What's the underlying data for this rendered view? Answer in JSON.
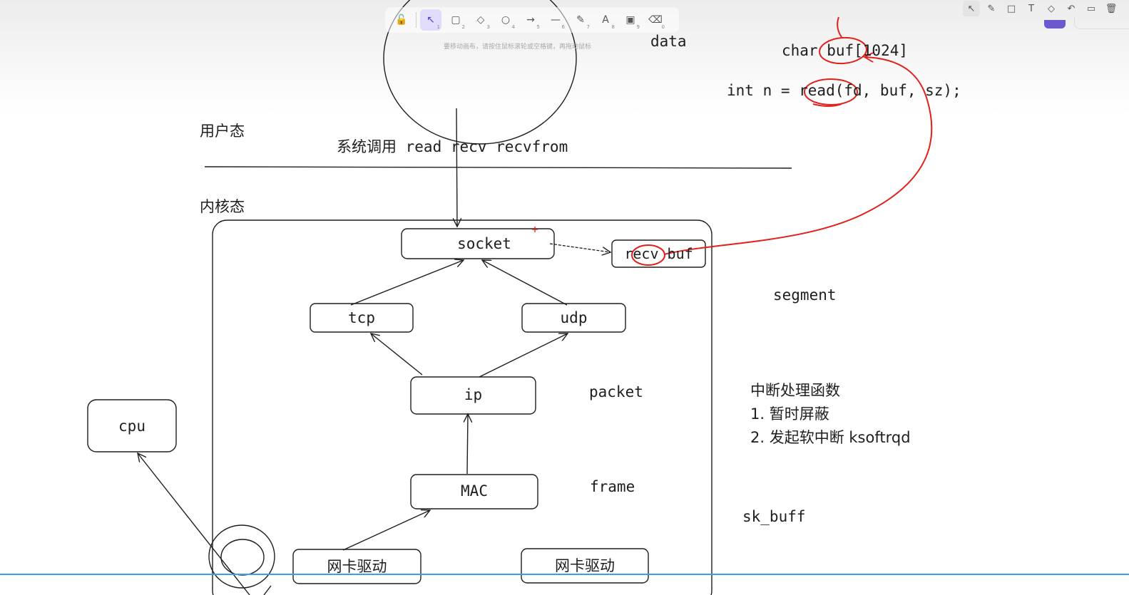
{
  "toolbar": {
    "tools": [
      {
        "name": "lock-tool",
        "glyph": "🔓",
        "sub": ""
      },
      {
        "name": "selection-tool",
        "glyph": "↖",
        "sub": "1"
      },
      {
        "name": "rectangle-tool",
        "glyph": "▢",
        "sub": "2"
      },
      {
        "name": "diamond-tool",
        "glyph": "◇",
        "sub": "3"
      },
      {
        "name": "ellipse-tool",
        "glyph": "○",
        "sub": "4"
      },
      {
        "name": "arrow-tool",
        "glyph": "→",
        "sub": "5"
      },
      {
        "name": "line-tool",
        "glyph": "—",
        "sub": "6"
      },
      {
        "name": "draw-tool",
        "glyph": "✎",
        "sub": "7"
      },
      {
        "name": "text-tool",
        "glyph": "A",
        "sub": "8"
      },
      {
        "name": "image-tool",
        "glyph": "▣",
        "sub": "9"
      },
      {
        "name": "eraser-tool",
        "glyph": "⌫",
        "sub": "0"
      }
    ],
    "active_tool": "selection-tool",
    "hint": "要移动画布，请按住鼠标滚轮或空格键，再拖动鼠标"
  },
  "annotation_toolbar": {
    "tools": [
      {
        "name": "pointer-icon",
        "glyph": "↖"
      },
      {
        "name": "pen-icon",
        "glyph": "✎"
      },
      {
        "name": "rectangle-icon",
        "glyph": "□"
      },
      {
        "name": "text-icon",
        "glyph": "T"
      },
      {
        "name": "eraser-icon",
        "glyph": "◇"
      },
      {
        "name": "undo-icon",
        "glyph": "↶"
      },
      {
        "name": "screen-icon",
        "glyph": "▭"
      },
      {
        "name": "trash-icon",
        "glyph": "🗑"
      }
    ]
  },
  "diagram": {
    "user_mode": "用户态",
    "kernel_mode": "内核态",
    "syscall": "系统调用 read recv recvfrom",
    "data_label": "data",
    "nodes": {
      "socket": "socket",
      "recv_buf": "recv buf",
      "tcp": "tcp",
      "udp": "udp",
      "ip": "ip",
      "mac": "MAC",
      "nic_driver_1": "网卡驱动",
      "nic_driver_2": "网卡驱动",
      "cpu": "cpu"
    },
    "layer_labels": {
      "segment": "segment",
      "packet": "packet",
      "frame": "frame",
      "sk_buff": "sk_buff"
    },
    "code": {
      "line1": "char buf[1024]",
      "line2": "int n = read(fd, buf, sz);"
    },
    "interrupt": {
      "title": "中断处理函数",
      "item1": "1. 暂时屏蔽",
      "item2": "2. 发起软中断 ksoftrqd"
    }
  },
  "colors": {
    "ink": "#1e1e1e",
    "annotation": "#e0201b",
    "active_tool": "#e0dcfa",
    "bottom_line": "#3aa0e6"
  }
}
